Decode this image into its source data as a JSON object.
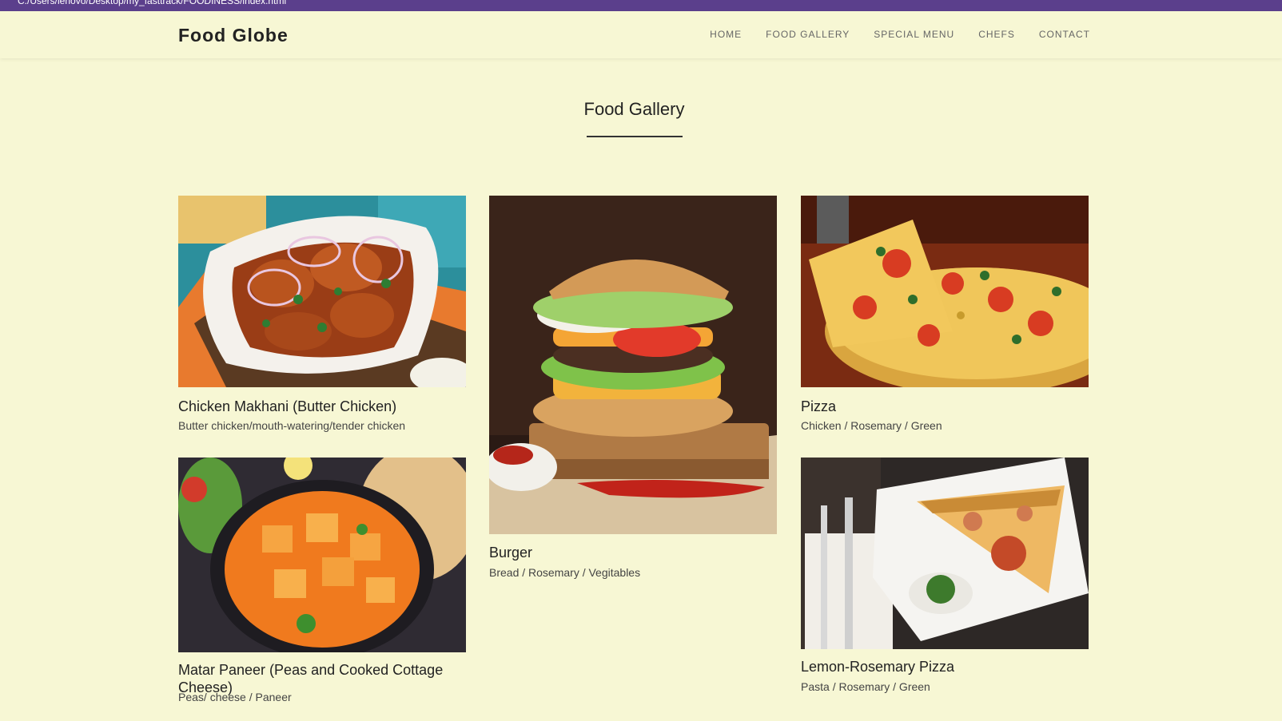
{
  "browser": {
    "address": "C:/Users/lenovo/Desktop/my_fasttrack/FOODINESS/index.html"
  },
  "brand": "Food Globe",
  "nav": [
    "HOME",
    "FOOD GALLERY",
    "SPECIAL MENU",
    "CHEFS",
    "CONTACT"
  ],
  "section_title": "Food Gallery",
  "gallery": [
    {
      "name": "Chicken Makhani (Butter Chicken)",
      "desc": "Butter chicken/mouth-watering/tender chicken"
    },
    {
      "name": "Burger",
      "desc": "Bread / Rosemary / Vegitables"
    },
    {
      "name": "Pizza",
      "desc": "Chicken / Rosemary / Green"
    },
    {
      "name": "Matar Paneer (Peas and Cooked Cottage Cheese)",
      "desc": "Peas/ cheese / Paneer"
    },
    {
      "name": "Lemon-Rosemary Pizza",
      "desc": "Pasta / Rosemary / Green"
    }
  ]
}
